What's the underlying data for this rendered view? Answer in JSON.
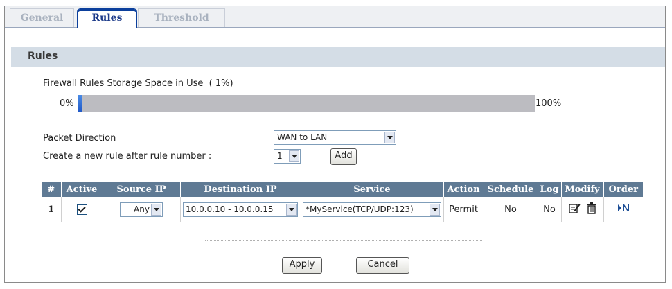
{
  "tabs": [
    {
      "label": "General",
      "active": false
    },
    {
      "label": "Rules",
      "active": true
    },
    {
      "label": "Threshold",
      "active": false
    }
  ],
  "section": {
    "title": "Rules"
  },
  "storage": {
    "label": "Firewall Rules Storage Space in Use",
    "percent_text": "( 1%)",
    "percent": 1,
    "min_label": "0%",
    "max_label": "100%"
  },
  "packet_direction": {
    "label": "Packet Direction",
    "value": "WAN to LAN"
  },
  "new_rule": {
    "label": "Create a new rule after rule number :",
    "value": "1",
    "add_label": "Add"
  },
  "table": {
    "headers": {
      "num": "#",
      "active": "Active",
      "source_ip": "Source IP",
      "destination_ip": "Destination IP",
      "service": "Service",
      "action": "Action",
      "schedule": "Schedule",
      "log": "Log",
      "modify": "Modify",
      "order": "Order"
    },
    "rows": [
      {
        "num": "1",
        "active": true,
        "source_ip": "Any",
        "destination_ip": "10.0.0.10 - 10.0.0.15",
        "service": "*MyService(TCP/UDP:123)",
        "action": "Permit",
        "schedule": "No",
        "log": "No"
      }
    ]
  },
  "buttons": {
    "apply": "Apply",
    "cancel": "Cancel"
  },
  "icons": {
    "edit": "edit-icon",
    "delete": "trash-icon",
    "order": "move-order-icon"
  },
  "colors": {
    "header_bg": "#5f7a94",
    "section_bg": "#d4dde6",
    "active_tab": "#0b3f9c",
    "bar": "#bcbcc1",
    "bar_fill": "#1f57c6"
  }
}
